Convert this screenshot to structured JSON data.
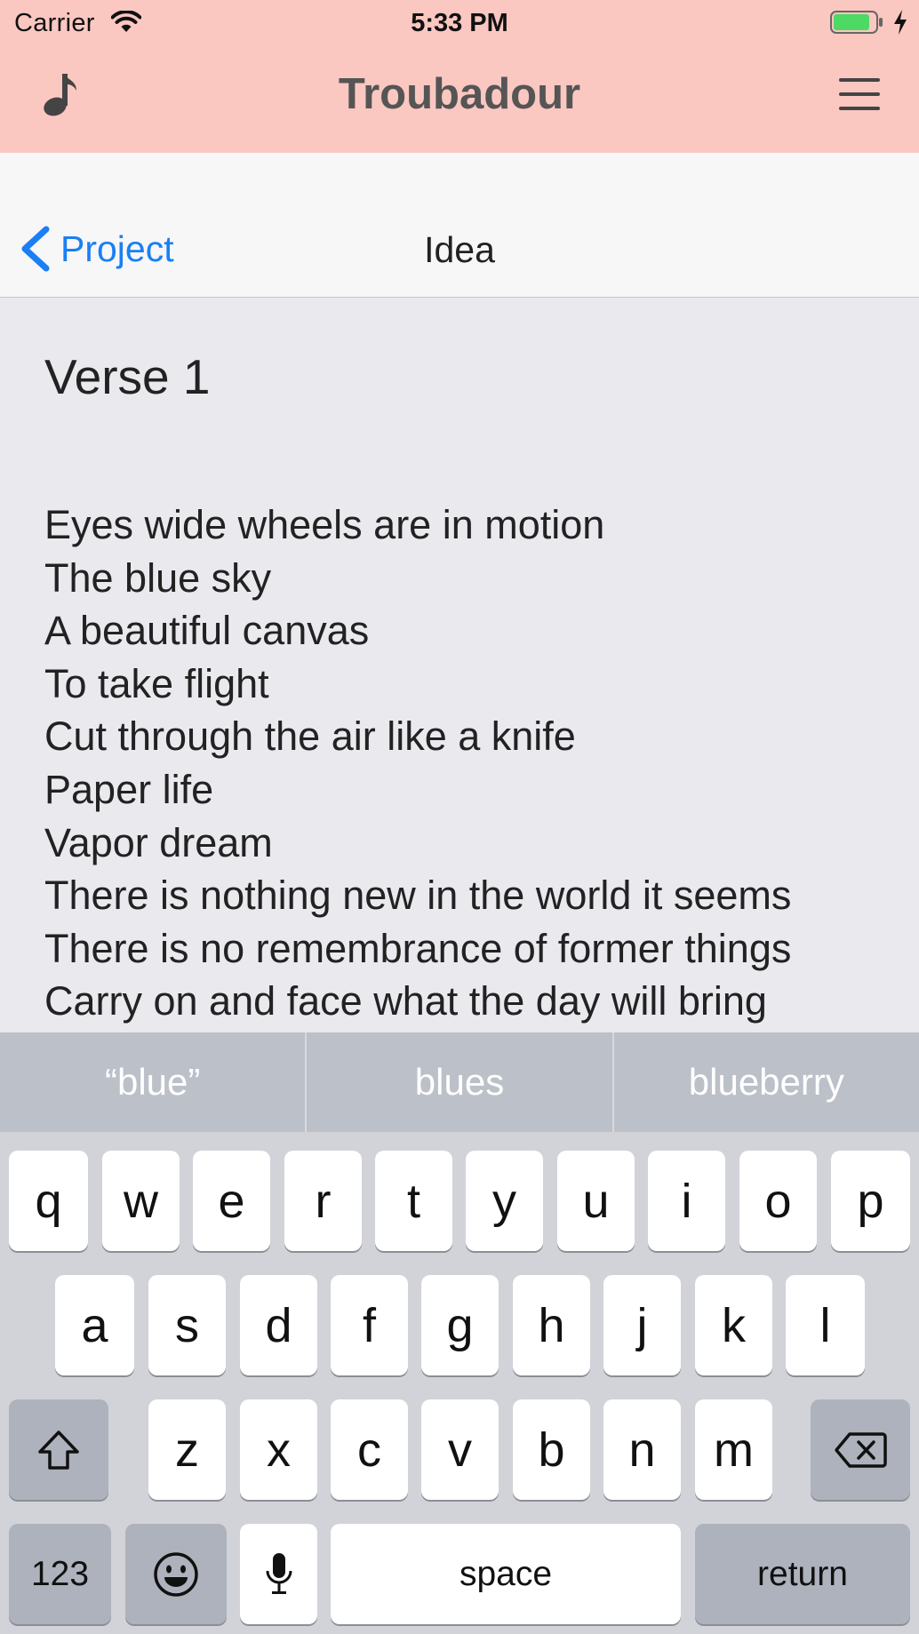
{
  "status_bar": {
    "carrier": "Carrier",
    "time": "5:33 PM"
  },
  "app_header": {
    "title": "Troubadour",
    "left_icon": "music-note-icon",
    "right_icon": "hamburger-menu-icon",
    "background": "#fbc7c1"
  },
  "nav_bar": {
    "back_label": "Project",
    "title": "Idea",
    "accent": "#1a7ff5"
  },
  "content": {
    "section_title": "Verse 1",
    "lines": [
      "Eyes wide wheels are in motion",
      "The blue sky",
      "A beautiful canvas",
      "To take flight",
      "Cut through the air like a knife",
      "Paper life",
      "Vapor dream",
      "There is nothing new in the world it seems",
      "There is no remembrance of former things",
      "Carry on and face what the day will bring"
    ]
  },
  "keyboard": {
    "suggestions": [
      "“blue”",
      "blues",
      "blueberry"
    ],
    "row1": [
      "q",
      "w",
      "e",
      "r",
      "t",
      "y",
      "u",
      "i",
      "o",
      "p"
    ],
    "row2": [
      "a",
      "s",
      "d",
      "f",
      "g",
      "h",
      "j",
      "k",
      "l"
    ],
    "row3": [
      "z",
      "x",
      "c",
      "v",
      "b",
      "n",
      "m"
    ],
    "numbers_label": "123",
    "space_label": "space",
    "return_label": "return",
    "icons": [
      "shift-icon",
      "delete-icon",
      "emoji-icon",
      "microphone-icon"
    ]
  }
}
